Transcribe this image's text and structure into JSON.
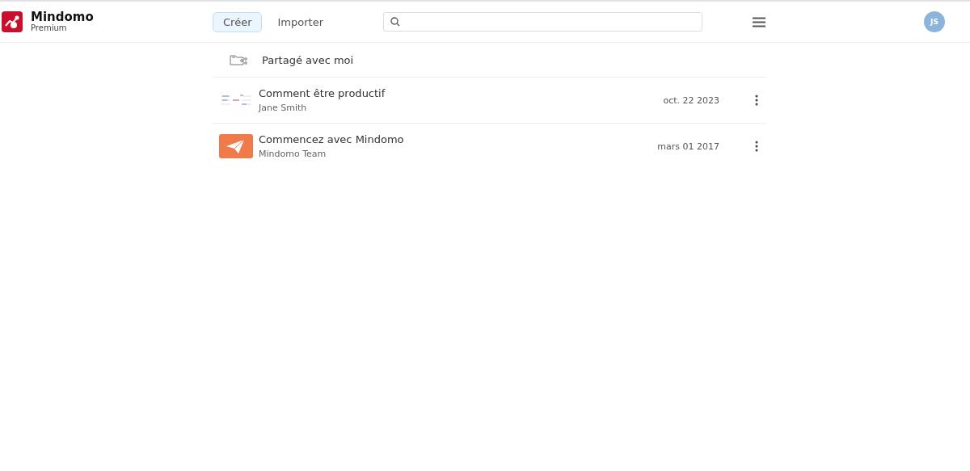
{
  "brand": {
    "name": "Mindomo",
    "plan": "Premium"
  },
  "tabs": [
    {
      "label": "Créer",
      "selected": true
    },
    {
      "label": "Importer",
      "selected": false
    }
  ],
  "avatar": "JS",
  "section": {
    "title": "Partagé avec moi"
  },
  "maps": [
    {
      "title": "Comment être productif",
      "owner": "Jane Smith",
      "date": "oct. 22 2023",
      "kind": "mindmap"
    },
    {
      "title": "Commencez avec Mindomo",
      "owner": "Mindomo Team",
      "date": "mars 01 2017",
      "kind": "plane"
    }
  ]
}
